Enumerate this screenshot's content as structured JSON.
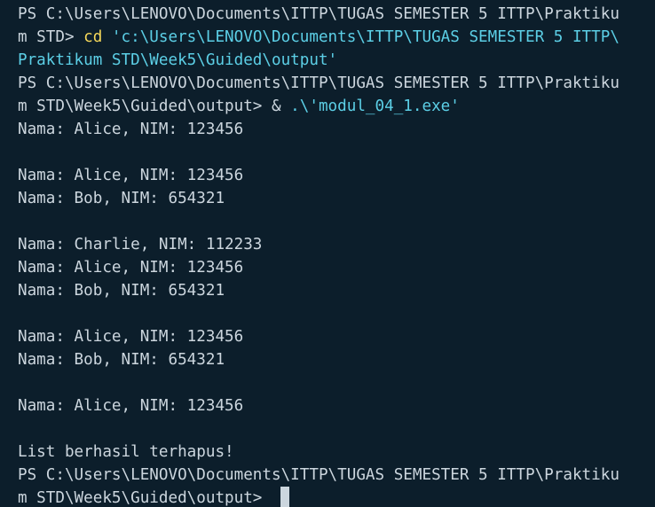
{
  "terminal": {
    "prompt_1": {
      "line_a": "PS C:\\Users\\LENOVO\\Documents\\ITTP\\TUGAS SEMESTER 5 ITTP\\Praktiku",
      "line_b_prefix": "m STD> ",
      "command": "cd",
      "arg_part_1": " 'c:\\Users\\LENOVO\\Documents\\ITTP\\TUGAS SEMESTER 5 ITTP\\",
      "arg_part_2": "Praktikum STD\\Week5\\Guided\\output'"
    },
    "prompt_2": {
      "line_a": "PS C:\\Users\\LENOVO\\Documents\\ITTP\\TUGAS SEMESTER 5 ITTP\\Praktiku",
      "line_b_prefix": "m STD\\Week5\\Guided\\output> ",
      "operator": "&",
      "exe": " .\\'modul_04_1.exe'"
    },
    "output": [
      "Nama: Alice, NIM: 123456",
      "",
      "Nama: Alice, NIM: 123456",
      "Nama: Bob, NIM: 654321",
      "",
      "Nama: Charlie, NIM: 112233",
      "Nama: Alice, NIM: 123456",
      "Nama: Bob, NIM: 654321",
      "",
      "Nama: Alice, NIM: 123456",
      "Nama: Bob, NIM: 654321",
      "",
      "Nama: Alice, NIM: 123456",
      "",
      "List berhasil terhapus!"
    ],
    "prompt_3": {
      "line_a": "PS C:\\Users\\LENOVO\\Documents\\ITTP\\TUGAS SEMESTER 5 ITTP\\Praktiku",
      "line_b_prefix": "m STD\\Week5\\Guided\\output> "
    }
  },
  "colors": {
    "background": "#0c1e2b",
    "foreground": "#ccd6de",
    "command": "#f5d85a",
    "string": "#5ccfe6"
  }
}
